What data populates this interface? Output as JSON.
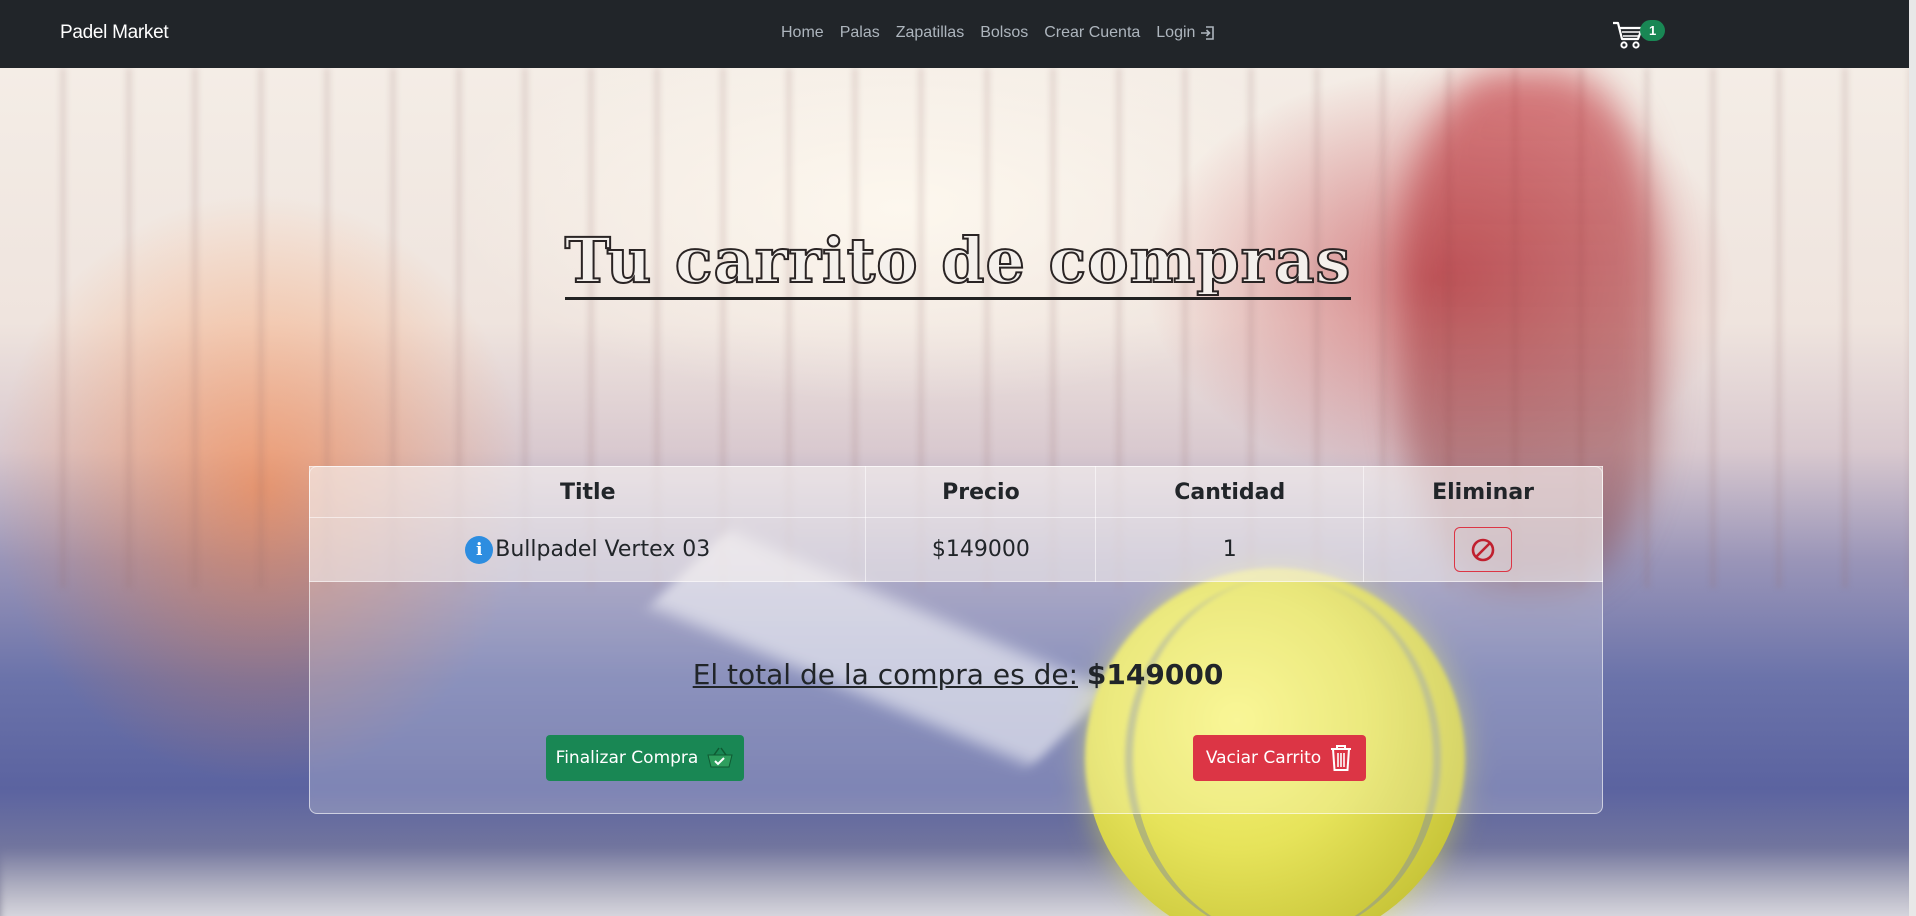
{
  "navbar": {
    "brand": "Padel Market",
    "links": [
      {
        "label": "Home"
      },
      {
        "label": "Palas"
      },
      {
        "label": "Zapatillas"
      },
      {
        "label": "Bolsos"
      },
      {
        "label": "Crear Cuenta"
      },
      {
        "label": "Login"
      }
    ],
    "cart_count": "1"
  },
  "page": {
    "title": "Tu carrito de compras"
  },
  "table": {
    "headers": [
      "Title",
      "Precio",
      "Cantidad",
      "Eliminar"
    ],
    "rows": [
      {
        "title": "Bullpadel Vertex 03",
        "price": "$149000",
        "quantity": "1"
      }
    ]
  },
  "total": {
    "label": "El total de la compra es de:",
    "amount": "$149000"
  },
  "actions": {
    "finish_label": "Finalizar Compra",
    "empty_label": "Vaciar Carrito"
  },
  "colors": {
    "navbar_bg": "#212529",
    "success": "#198754",
    "danger": "#dc3545",
    "info": "#2d8de0"
  }
}
